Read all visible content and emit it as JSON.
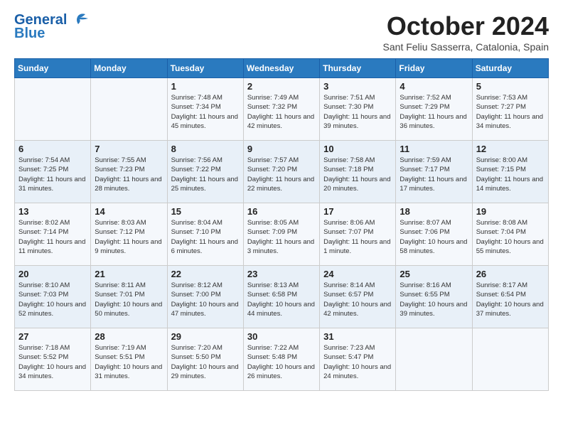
{
  "header": {
    "logo_line1": "General",
    "logo_line2": "Blue",
    "month_title": "October 2024",
    "location": "Sant Feliu Sasserra, Catalonia, Spain"
  },
  "days_of_week": [
    "Sunday",
    "Monday",
    "Tuesday",
    "Wednesday",
    "Thursday",
    "Friday",
    "Saturday"
  ],
  "weeks": [
    [
      {
        "day": "",
        "content": ""
      },
      {
        "day": "",
        "content": ""
      },
      {
        "day": "1",
        "content": "Sunrise: 7:48 AM\nSunset: 7:34 PM\nDaylight: 11 hours and 45 minutes."
      },
      {
        "day": "2",
        "content": "Sunrise: 7:49 AM\nSunset: 7:32 PM\nDaylight: 11 hours and 42 minutes."
      },
      {
        "day": "3",
        "content": "Sunrise: 7:51 AM\nSunset: 7:30 PM\nDaylight: 11 hours and 39 minutes."
      },
      {
        "day": "4",
        "content": "Sunrise: 7:52 AM\nSunset: 7:29 PM\nDaylight: 11 hours and 36 minutes."
      },
      {
        "day": "5",
        "content": "Sunrise: 7:53 AM\nSunset: 7:27 PM\nDaylight: 11 hours and 34 minutes."
      }
    ],
    [
      {
        "day": "6",
        "content": "Sunrise: 7:54 AM\nSunset: 7:25 PM\nDaylight: 11 hours and 31 minutes."
      },
      {
        "day": "7",
        "content": "Sunrise: 7:55 AM\nSunset: 7:23 PM\nDaylight: 11 hours and 28 minutes."
      },
      {
        "day": "8",
        "content": "Sunrise: 7:56 AM\nSunset: 7:22 PM\nDaylight: 11 hours and 25 minutes."
      },
      {
        "day": "9",
        "content": "Sunrise: 7:57 AM\nSunset: 7:20 PM\nDaylight: 11 hours and 22 minutes."
      },
      {
        "day": "10",
        "content": "Sunrise: 7:58 AM\nSunset: 7:18 PM\nDaylight: 11 hours and 20 minutes."
      },
      {
        "day": "11",
        "content": "Sunrise: 7:59 AM\nSunset: 7:17 PM\nDaylight: 11 hours and 17 minutes."
      },
      {
        "day": "12",
        "content": "Sunrise: 8:00 AM\nSunset: 7:15 PM\nDaylight: 11 hours and 14 minutes."
      }
    ],
    [
      {
        "day": "13",
        "content": "Sunrise: 8:02 AM\nSunset: 7:14 PM\nDaylight: 11 hours and 11 minutes."
      },
      {
        "day": "14",
        "content": "Sunrise: 8:03 AM\nSunset: 7:12 PM\nDaylight: 11 hours and 9 minutes."
      },
      {
        "day": "15",
        "content": "Sunrise: 8:04 AM\nSunset: 7:10 PM\nDaylight: 11 hours and 6 minutes."
      },
      {
        "day": "16",
        "content": "Sunrise: 8:05 AM\nSunset: 7:09 PM\nDaylight: 11 hours and 3 minutes."
      },
      {
        "day": "17",
        "content": "Sunrise: 8:06 AM\nSunset: 7:07 PM\nDaylight: 11 hours and 1 minute."
      },
      {
        "day": "18",
        "content": "Sunrise: 8:07 AM\nSunset: 7:06 PM\nDaylight: 10 hours and 58 minutes."
      },
      {
        "day": "19",
        "content": "Sunrise: 8:08 AM\nSunset: 7:04 PM\nDaylight: 10 hours and 55 minutes."
      }
    ],
    [
      {
        "day": "20",
        "content": "Sunrise: 8:10 AM\nSunset: 7:03 PM\nDaylight: 10 hours and 52 minutes."
      },
      {
        "day": "21",
        "content": "Sunrise: 8:11 AM\nSunset: 7:01 PM\nDaylight: 10 hours and 50 minutes."
      },
      {
        "day": "22",
        "content": "Sunrise: 8:12 AM\nSunset: 7:00 PM\nDaylight: 10 hours and 47 minutes."
      },
      {
        "day": "23",
        "content": "Sunrise: 8:13 AM\nSunset: 6:58 PM\nDaylight: 10 hours and 44 minutes."
      },
      {
        "day": "24",
        "content": "Sunrise: 8:14 AM\nSunset: 6:57 PM\nDaylight: 10 hours and 42 minutes."
      },
      {
        "day": "25",
        "content": "Sunrise: 8:16 AM\nSunset: 6:55 PM\nDaylight: 10 hours and 39 minutes."
      },
      {
        "day": "26",
        "content": "Sunrise: 8:17 AM\nSunset: 6:54 PM\nDaylight: 10 hours and 37 minutes."
      }
    ],
    [
      {
        "day": "27",
        "content": "Sunrise: 7:18 AM\nSunset: 5:52 PM\nDaylight: 10 hours and 34 minutes."
      },
      {
        "day": "28",
        "content": "Sunrise: 7:19 AM\nSunset: 5:51 PM\nDaylight: 10 hours and 31 minutes."
      },
      {
        "day": "29",
        "content": "Sunrise: 7:20 AM\nSunset: 5:50 PM\nDaylight: 10 hours and 29 minutes."
      },
      {
        "day": "30",
        "content": "Sunrise: 7:22 AM\nSunset: 5:48 PM\nDaylight: 10 hours and 26 minutes."
      },
      {
        "day": "31",
        "content": "Sunrise: 7:23 AM\nSunset: 5:47 PM\nDaylight: 10 hours and 24 minutes."
      },
      {
        "day": "",
        "content": ""
      },
      {
        "day": "",
        "content": ""
      }
    ]
  ]
}
